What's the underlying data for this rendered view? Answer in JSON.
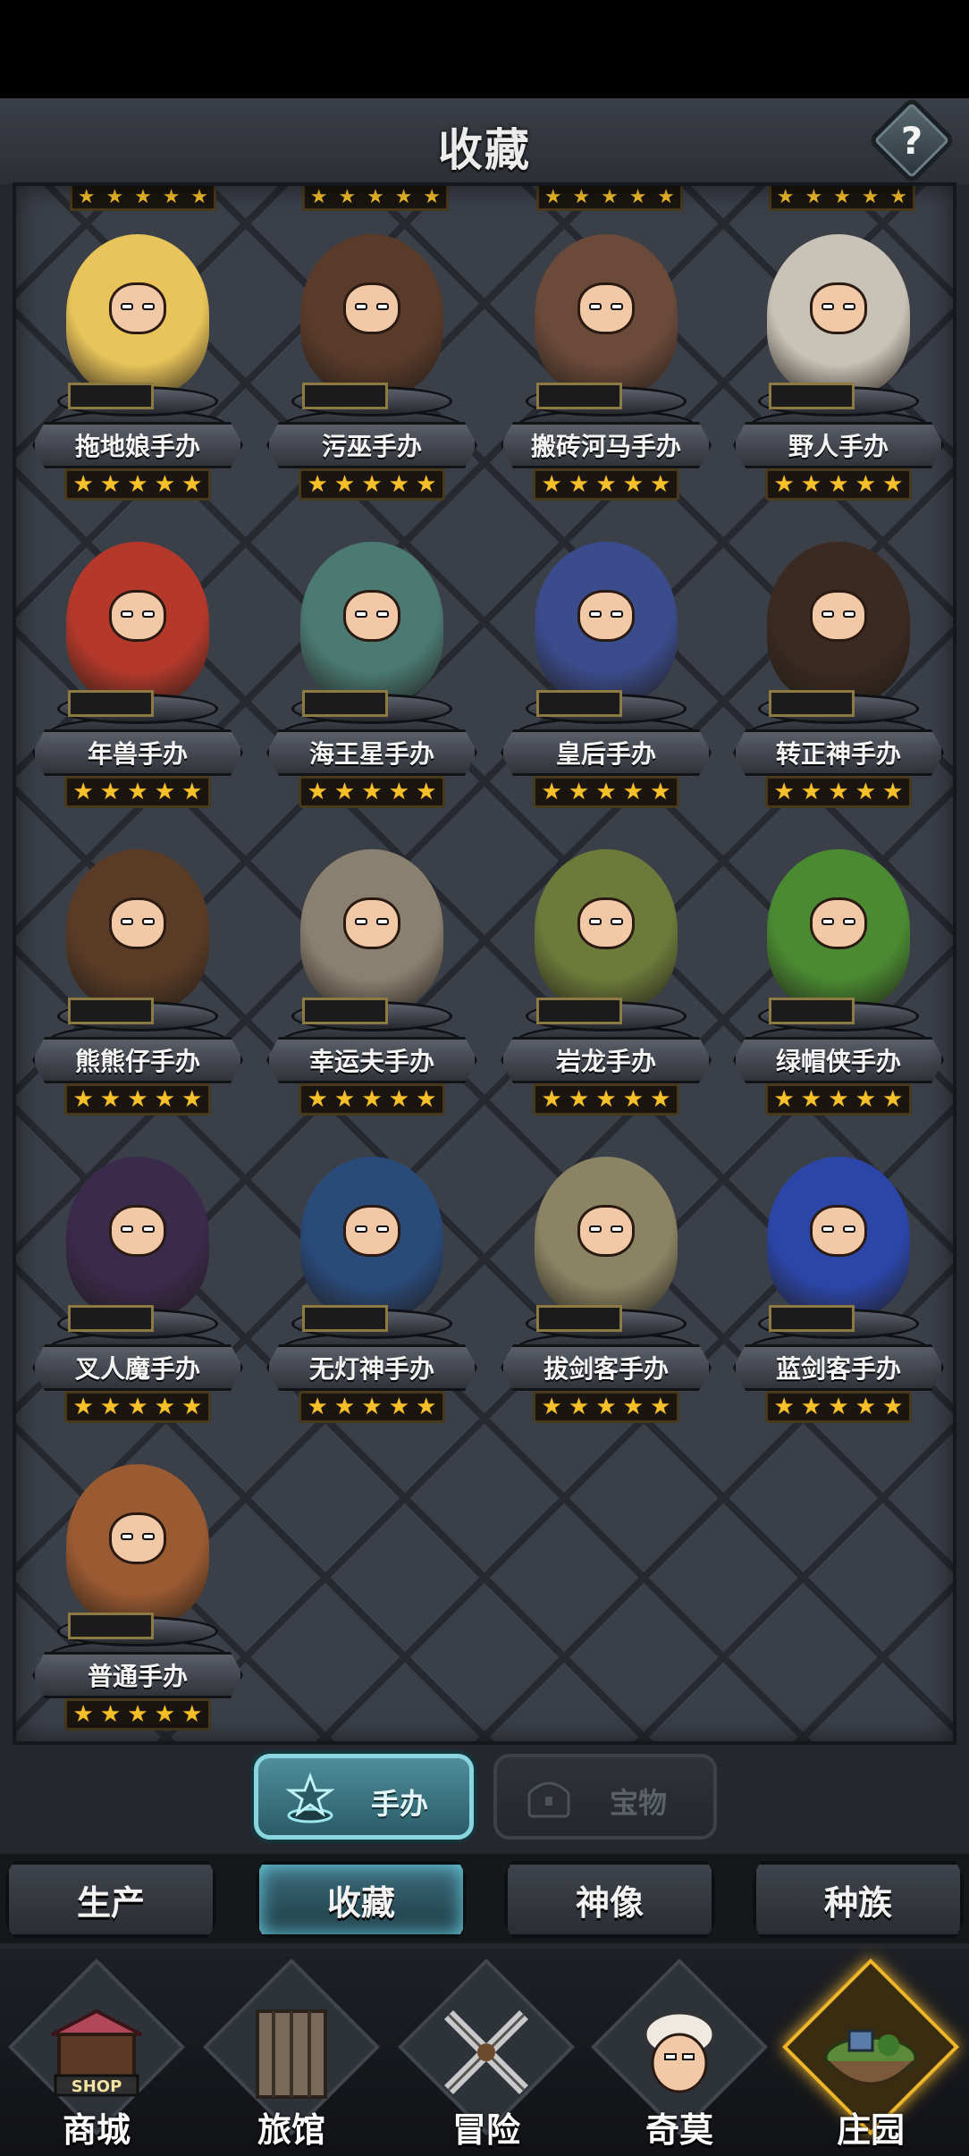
{
  "header": {
    "title": "收藏",
    "help_label": "?"
  },
  "colors": {
    "star": "#f6c02a",
    "active_tab": "#4e8e9a",
    "panel_bg": "#3b3f48"
  },
  "collection": {
    "items": [
      {
        "name": "拖地娘手办",
        "stars": "★★★★★",
        "figure_color": "#e8c45a"
      },
      {
        "name": "污巫手办",
        "stars": "★★★★★",
        "figure_color": "#5a3b2a"
      },
      {
        "name": "搬砖河马手办",
        "stars": "★★★★★",
        "figure_color": "#6b4a3a"
      },
      {
        "name": "野人手办",
        "stars": "★★★★★",
        "figure_color": "#c9c2b6"
      },
      {
        "name": "年兽手办",
        "stars": "★★★★★",
        "figure_color": "#b4392b"
      },
      {
        "name": "海王星手办",
        "stars": "★★★★★",
        "figure_color": "#4a7a72"
      },
      {
        "name": "皇后手办",
        "stars": "★★★★★",
        "figure_color": "#3a4c8c"
      },
      {
        "name": "转正神手办",
        "stars": "★★★★★",
        "figure_color": "#3a2a22"
      },
      {
        "name": "熊熊仔手办",
        "stars": "★★★★★",
        "figure_color": "#5a3c26"
      },
      {
        "name": "幸运夫手办",
        "stars": "★★★★★",
        "figure_color": "#8a8070"
      },
      {
        "name": "岩龙手办",
        "stars": "★★★★★",
        "figure_color": "#6c7a3a"
      },
      {
        "name": "绿帽侠手办",
        "stars": "★★★★★",
        "figure_color": "#4a8a32"
      },
      {
        "name": "叉人魔手办",
        "stars": "★★★★★",
        "figure_color": "#3a2a4c"
      },
      {
        "name": "无灯神手办",
        "stars": "★★★★★",
        "figure_color": "#2a4a7a"
      },
      {
        "name": "拔剑客手办",
        "stars": "★★★★★",
        "figure_color": "#8a8464"
      },
      {
        "name": "蓝剑客手办",
        "stars": "★★★★★",
        "figure_color": "#2c46a8"
      },
      {
        "name": "普通手办",
        "stars": "★★★★★",
        "figure_color": "#9a5a32"
      }
    ],
    "peek_stars": "★★★★★"
  },
  "subtabs": {
    "figures": "手办",
    "treasures": "宝物"
  },
  "tabs": [
    {
      "label": "生产"
    },
    {
      "label": "收藏"
    },
    {
      "label": "神像"
    },
    {
      "label": "种族"
    }
  ],
  "nav": [
    {
      "label": "商城",
      "sign": "SHOP"
    },
    {
      "label": "旅馆"
    },
    {
      "label": "冒险"
    },
    {
      "label": "奇莫"
    },
    {
      "label": "庄园"
    }
  ]
}
